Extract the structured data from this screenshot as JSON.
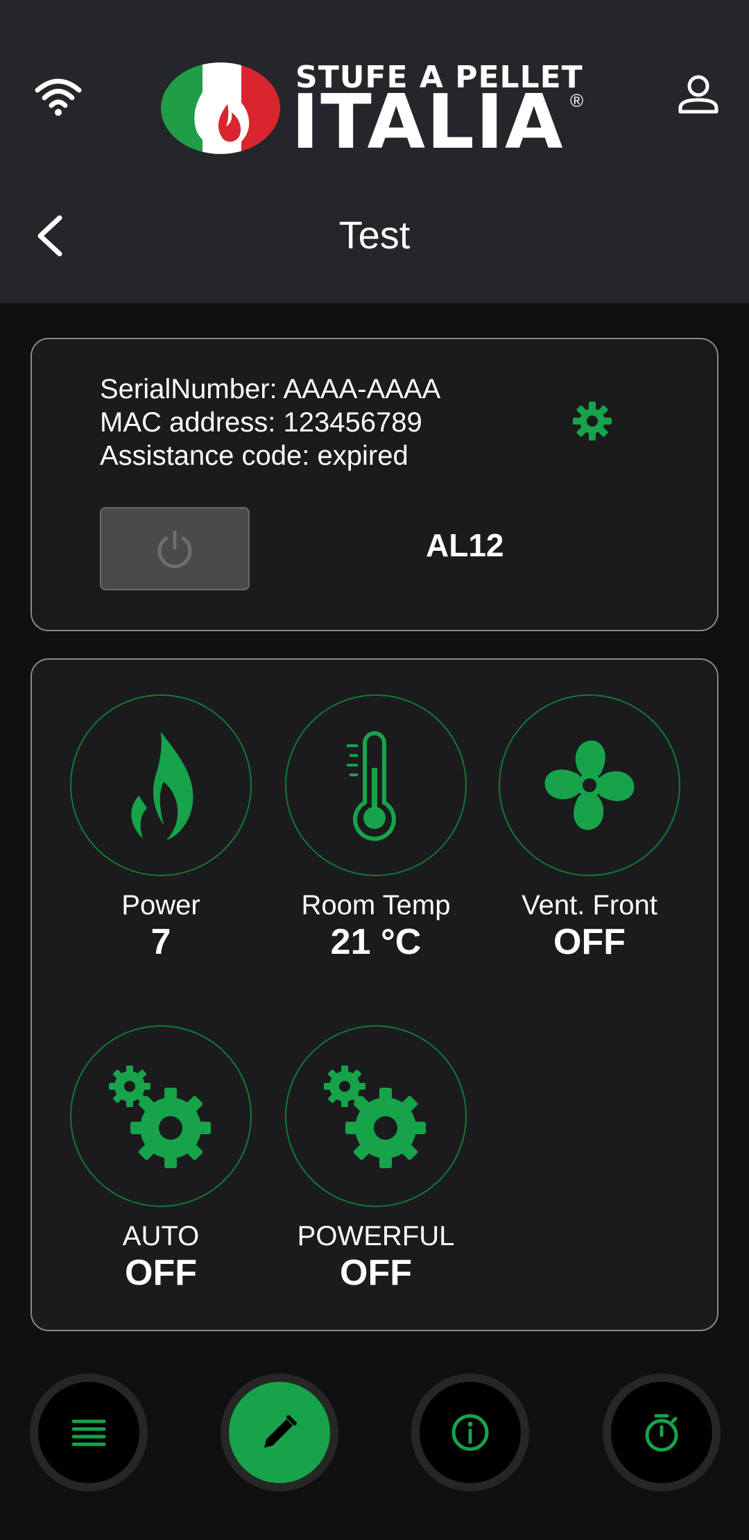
{
  "header": {
    "logo_line1": "STUFE A PELLET",
    "logo_line2": "ITALIA",
    "logo_reg": "®",
    "page_title": "Test"
  },
  "info": {
    "serial": "SerialNumber: AAAA-AAAA",
    "mac": "MAC address: 123456789",
    "assistance": "Assistance code: expired",
    "code": "AL12"
  },
  "controls": [
    {
      "label": "Power",
      "value": "7",
      "icon": "flame-icon"
    },
    {
      "label": "Room Temp",
      "value": "21 °C",
      "icon": "thermometer-icon"
    },
    {
      "label": "Vent. Front",
      "value": "OFF",
      "icon": "fan-icon"
    },
    {
      "label": "AUTO",
      "value": "OFF",
      "icon": "gears-icon"
    },
    {
      "label": "POWERFUL",
      "value": "OFF",
      "icon": "gears-icon"
    }
  ],
  "bottom_nav": [
    "menu-icon",
    "edit-icon",
    "info-icon",
    "timer-icon"
  ],
  "colors": {
    "accent": "#17a34a",
    "header_bg": "#252629",
    "page_bg": "#101010",
    "card_bg": "#1b1b1d",
    "flag_green": "#1f9d47",
    "flag_red": "#d9252d"
  }
}
